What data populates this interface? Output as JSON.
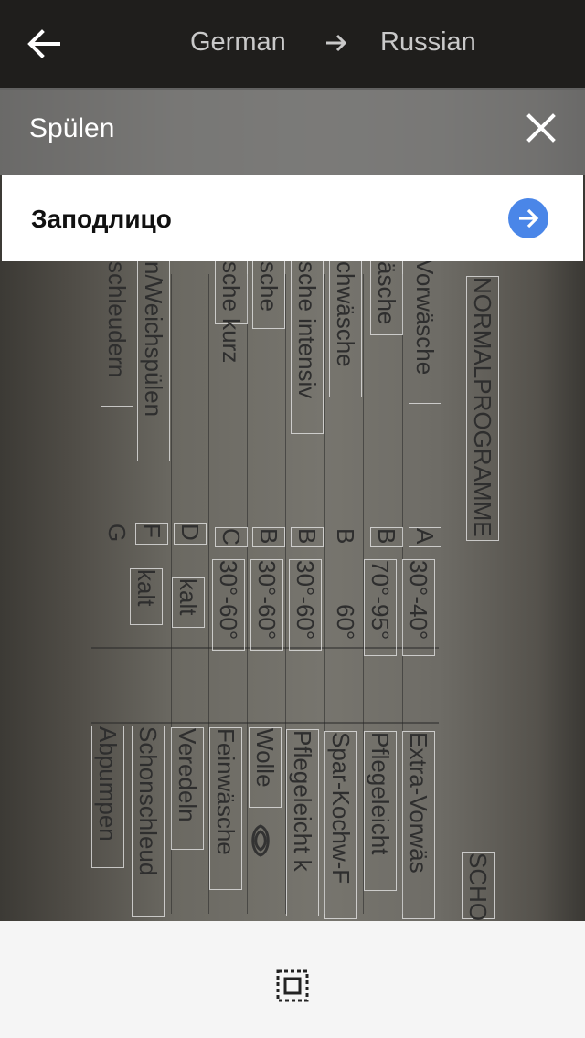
{
  "header": {
    "source_language": "German",
    "target_language": "Russian"
  },
  "icons": {
    "back": "arrow-left-icon",
    "direction": "arrow-right-icon",
    "close": "close-icon",
    "go": "arrow-right-circle-icon",
    "select_all": "select-all-icon"
  },
  "selection": {
    "word": "Spülen",
    "translation": "Заподлицо"
  },
  "camera_text": {
    "col1": [
      "NORMALPROGRAMME"
    ],
    "col2": [
      "Vorwäsche",
      "A",
      "30°-40°"
    ],
    "col3": [
      "äsche",
      "B",
      "70°-95°"
    ],
    "col4": [
      "chwäsche",
      "B",
      "60°"
    ],
    "col5": [
      "sche intensiv",
      "B",
      "30°-60°"
    ],
    "col6": [
      "sche",
      "B",
      "30°-60°"
    ],
    "col7": [
      "sche kurz",
      "C",
      "30°-60°"
    ],
    "col8": [
      "n/Weichspülen",
      "D",
      "kalt"
    ],
    "col9": [
      "F",
      "kalt"
    ],
    "col10": [
      "schleudern",
      "G"
    ],
    "lower": [
      "SCHO",
      "Extra-Vorwäs",
      "Pflegeleicht",
      "Spar-Kochw-F",
      "Pflegeleicht k",
      "Wolle",
      "Feinwäsche",
      "Veredeln",
      "Schonschleud",
      "Abpumpen"
    ]
  },
  "colors": {
    "accent": "#4a86e8",
    "panel_overlay": "#7d7d7d",
    "bottom_bar": "#f5f5f5"
  }
}
